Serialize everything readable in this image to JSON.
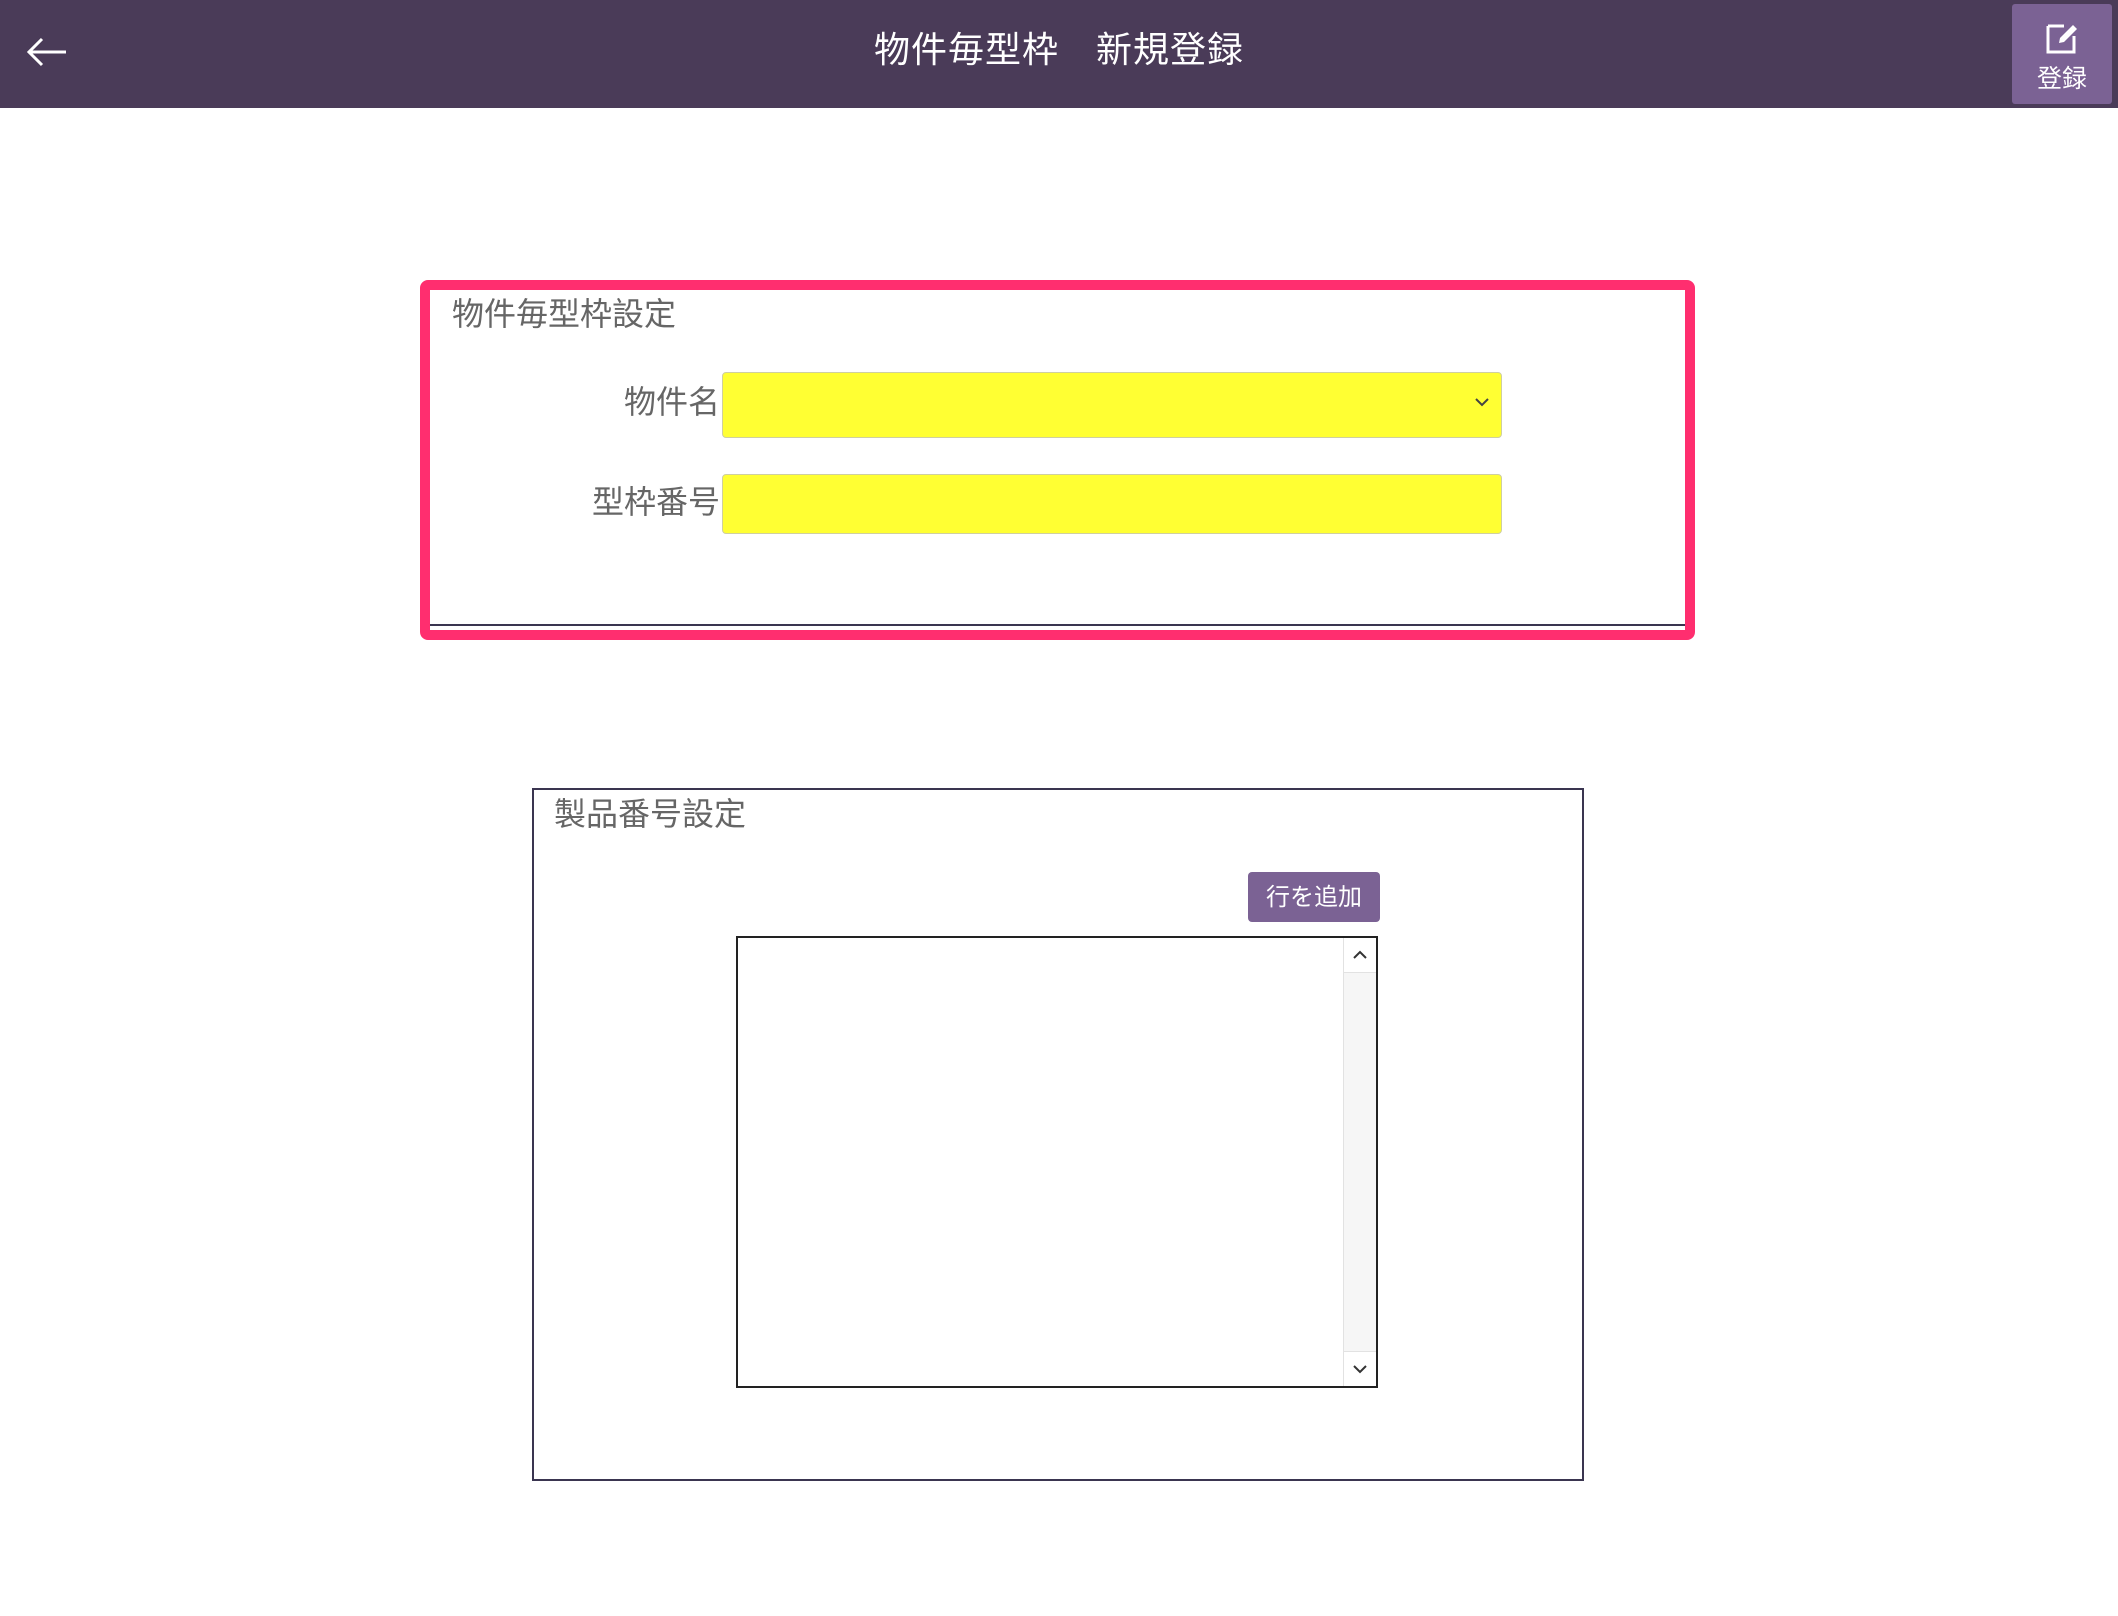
{
  "header": {
    "title": "物件毎型枠　新規登録",
    "back_icon": "arrow-left-icon",
    "register_label": "登録",
    "register_icon": "edit-icon",
    "background_color": "#4a3b58",
    "button_color": "#7b6294"
  },
  "section1": {
    "title": "物件毎型枠設定",
    "property_name_label": "物件名",
    "property_name_value": "",
    "mold_number_label": "型枠番号",
    "mold_number_value": "",
    "field_color": "#ffff33",
    "highlight_color": "#ff2e6f"
  },
  "section2": {
    "title": "製品番号設定",
    "add_row_label": "行を追加",
    "list_items": []
  }
}
